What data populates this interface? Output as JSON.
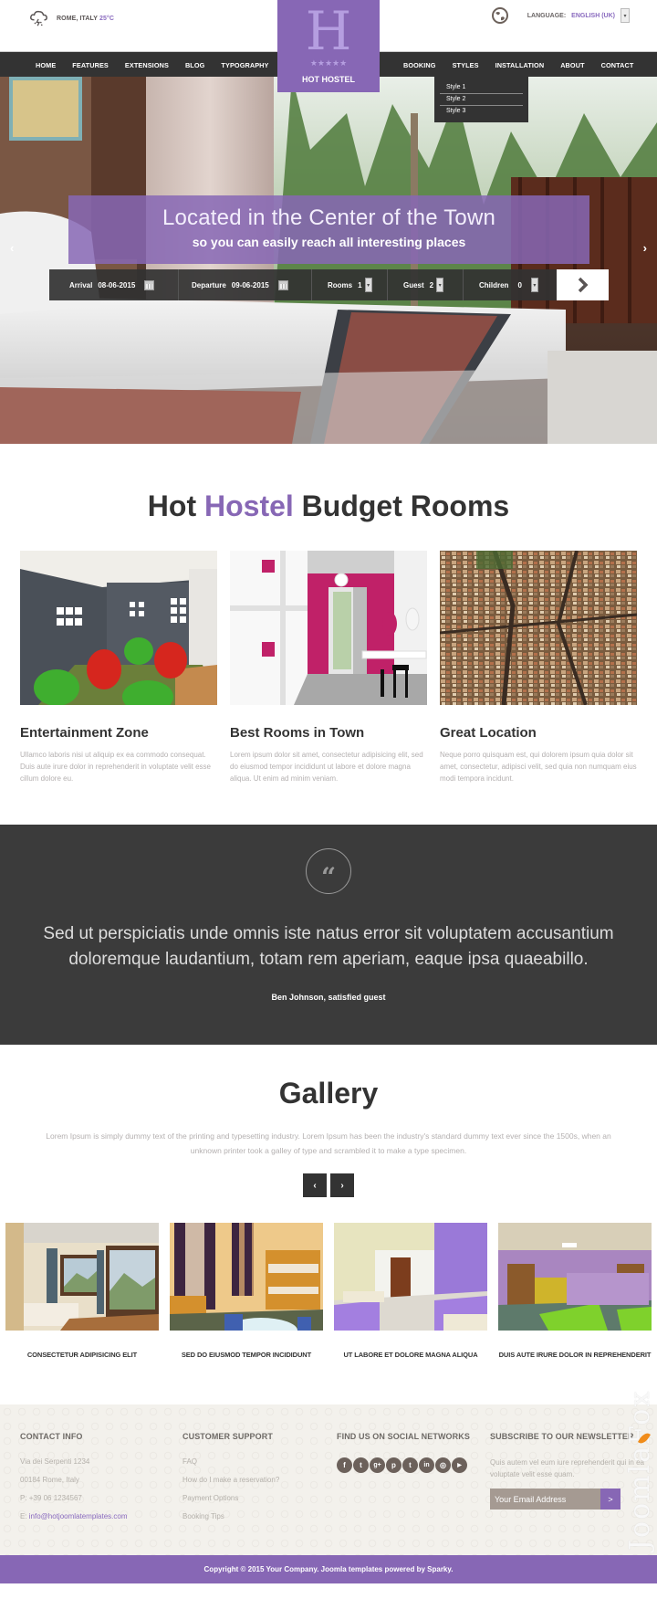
{
  "header": {
    "weather_location": "ROME, ITALY",
    "weather_temp": "25°C",
    "language_label": "LANGUAGE:",
    "language_value": "ENGLISH (UK)",
    "logo_letter": "H",
    "logo_stars": "★★★★★",
    "logo_name": "HOT HOSTEL"
  },
  "nav": {
    "left": [
      "HOME",
      "FEATURES",
      "EXTENSIONS",
      "BLOG",
      "TYPOGRAPHY"
    ],
    "right": [
      "BOOKING",
      "STYLES",
      "INSTALLATION",
      "ABOUT",
      "CONTACT"
    ],
    "styles_dropdown": [
      "Style 1",
      "Style 2",
      "Style 3"
    ]
  },
  "hero": {
    "title": "Located in the Center of the Town",
    "subtitle": "so you can easily reach all interesting places",
    "booking": {
      "arrival_label": "Arrival",
      "arrival_value": "08-06-2015",
      "departure_label": "Departure",
      "departure_value": "09-06-2015",
      "rooms_label": "Rooms",
      "rooms_value": "1",
      "guest_label": "Guest",
      "guest_value": "2",
      "children_label": "Children",
      "children_value": "0",
      "submit_icon": "›"
    },
    "prev_arrow": "‹",
    "next_arrow": "›"
  },
  "rooms": {
    "title_part1": "Hot",
    "title_accent": "Hostel",
    "title_part2": "Budget Rooms",
    "items": [
      {
        "title": "Entertainment Zone",
        "text": "Ullamco laboris nisi ut aliquip ex ea commodo consequat. Duis aute irure dolor in reprehenderit in voluptate velit esse cillum dolore eu."
      },
      {
        "title": "Best Rooms in Town",
        "text": "Lorem ipsum dolor sit amet, consectetur adipisicing elit, sed do eiusmod tempor incididunt ut labore et dolore magna aliqua. Ut enim ad minim veniam."
      },
      {
        "title": "Great Location",
        "text": "Neque porro quisquam est, qui dolorem ipsum quia dolor sit amet, consectetur, adipisci velit, sed quia non numquam eius modi tempora incidunt."
      }
    ]
  },
  "testimonial": {
    "quote_icon": "“",
    "text": "Sed ut perspiciatis unde omnis iste natus error sit voluptatem accusantium doloremque laudantium, totam rem aperiam, eaque ipsa quaeabillo.",
    "author": "Ben Johnson, satisfied guest"
  },
  "gallery": {
    "title": "Gallery",
    "description": "Lorem Ipsum is simply dummy text of the printing and typesetting industry. Lorem Ipsum has been the industry's standard dummy text ever since the 1500s, when an unknown printer took a galley of type and scrambled it to make a type specimen.",
    "prev": "‹",
    "next": "›",
    "items": [
      {
        "caption": "CONSECTETUR ADIPISICING ELIT"
      },
      {
        "caption": "SED DO EIUSMOD TEMPOR INCIDIDUNT"
      },
      {
        "caption": "UT LABORE ET DOLORE MAGNA ALIQUA"
      },
      {
        "caption": "DUIS AUTE IRURE DOLOR IN REPREHENDERIT"
      }
    ]
  },
  "footer": {
    "contact": {
      "title": "CONTACT INFO",
      "lines": [
        "Via dei Serpenti 1234",
        "00184 Rome, Italy",
        "P: +39 06 1234567"
      ],
      "email_prefix": "E: ",
      "email": "info@hotjoomlatemplates.com"
    },
    "support": {
      "title": "CUSTOMER SUPPORT",
      "links": [
        "FAQ",
        "How do I make a reservation?",
        "Payment Options",
        "Booking Tips"
      ]
    },
    "social": {
      "title": "FIND US ON SOCIAL NETWORKS",
      "icons": [
        {
          "name": "facebook-icon",
          "glyph": "f"
        },
        {
          "name": "twitter-icon",
          "glyph": "t"
        },
        {
          "name": "google-plus-icon",
          "glyph": "g+"
        },
        {
          "name": "pinterest-icon",
          "glyph": "p"
        },
        {
          "name": "tumblr-icon",
          "glyph": "t"
        },
        {
          "name": "linkedin-icon",
          "glyph": "in"
        },
        {
          "name": "dribbble-icon",
          "glyph": "◎"
        },
        {
          "name": "youtube-icon",
          "glyph": "▶"
        }
      ]
    },
    "newsletter": {
      "title": "SUBSCRIBE TO OUR NEWSLETTER",
      "text": "Quis autem vel eum iure reprehenderit qui in ea voluptate velit esse quam.",
      "placeholder": "Your Email Address",
      "button": ">"
    },
    "watermark": "JoomlaFox",
    "copyright": "Copyright © 2015 Your Company. Joomla templates powered by Sparky."
  },
  "colors": {
    "accent": "#8767b5",
    "dark": "#333333",
    "footer_bg": "#f3f1ec"
  }
}
